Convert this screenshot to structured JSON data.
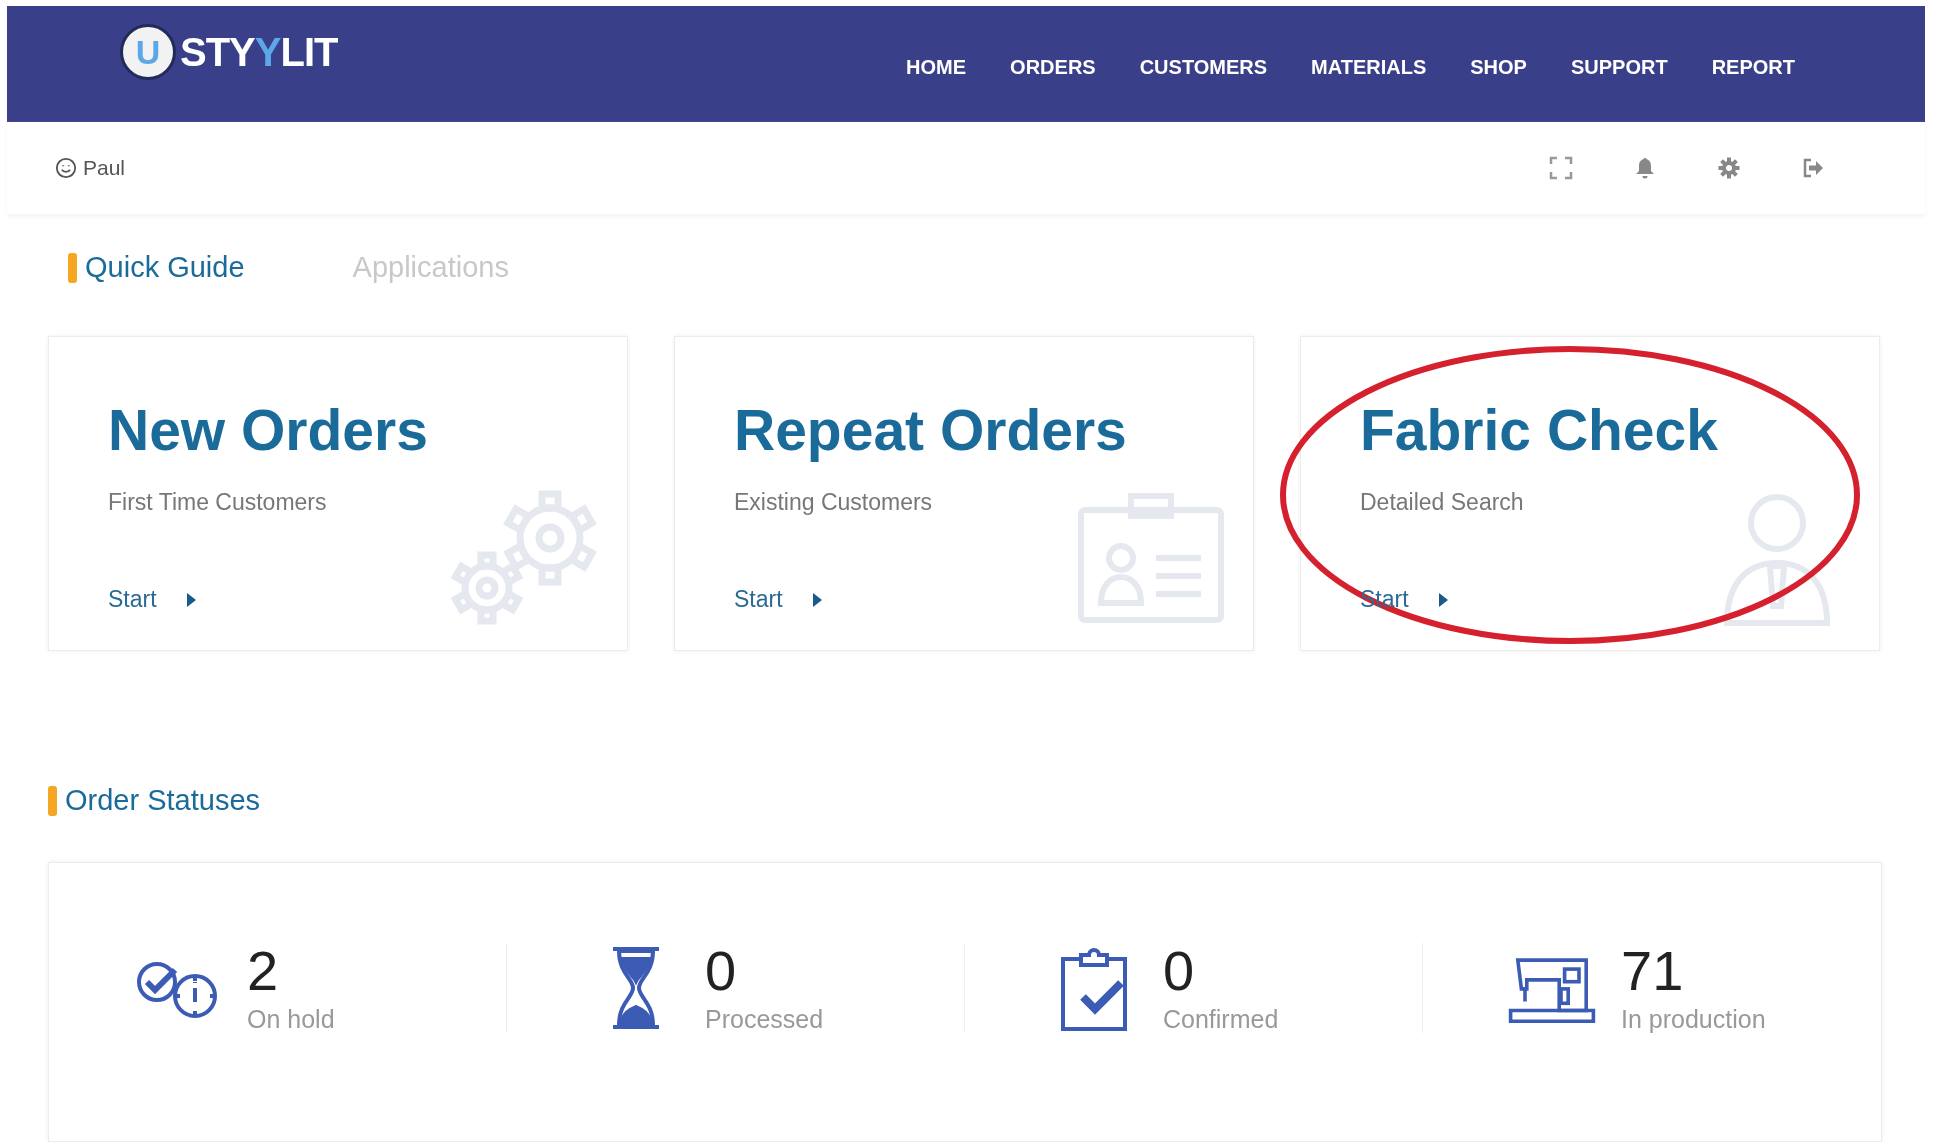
{
  "header": {
    "logo": {
      "mark": "U",
      "text_start": "STY",
      "text_accent": "Y",
      "text_end": "LIT"
    },
    "nav": [
      {
        "label": "HOME",
        "selected": false
      },
      {
        "label": "ORDERS",
        "selected": false
      },
      {
        "label": "CUSTOMERS",
        "selected": false
      },
      {
        "label": "MATERIALS",
        "selected": false
      },
      {
        "label": "SHOP",
        "selected": false
      },
      {
        "label": "SUPPORT",
        "selected": false
      },
      {
        "label": "REPORT",
        "selected": false
      }
    ]
  },
  "user_bar": {
    "user": "Paul",
    "actions": [
      {
        "kind": "fullscreen"
      },
      {
        "kind": "bell"
      },
      {
        "kind": "gear"
      },
      {
        "kind": "logout"
      }
    ]
  },
  "tabs": [
    {
      "label": "Quick Guide",
      "selected": true
    },
    {
      "label": "Applications",
      "selected": false
    }
  ],
  "cards": [
    {
      "title": "New Orders",
      "subtitle": "First Time Customers",
      "action": "Start",
      "kind": "gears",
      "highlighted": false
    },
    {
      "title": "Repeat Orders",
      "subtitle": "Existing Customers",
      "action": "Start",
      "kind": "id-card",
      "highlighted": false
    },
    {
      "title": "Fabric Check",
      "subtitle": "Detailed Search",
      "action": "Start",
      "kind": "person",
      "highlighted": true
    }
  ],
  "order_statuses": {
    "title": "Order Statuses",
    "items": [
      {
        "kind": "on-hold",
        "count": "2",
        "label": "On hold"
      },
      {
        "kind": "processed",
        "count": "0",
        "label": "Processed"
      },
      {
        "kind": "confirmed",
        "count": "0",
        "label": "Confirmed"
      },
      {
        "kind": "production",
        "count": "71",
        "label": "In production"
      }
    ]
  }
}
